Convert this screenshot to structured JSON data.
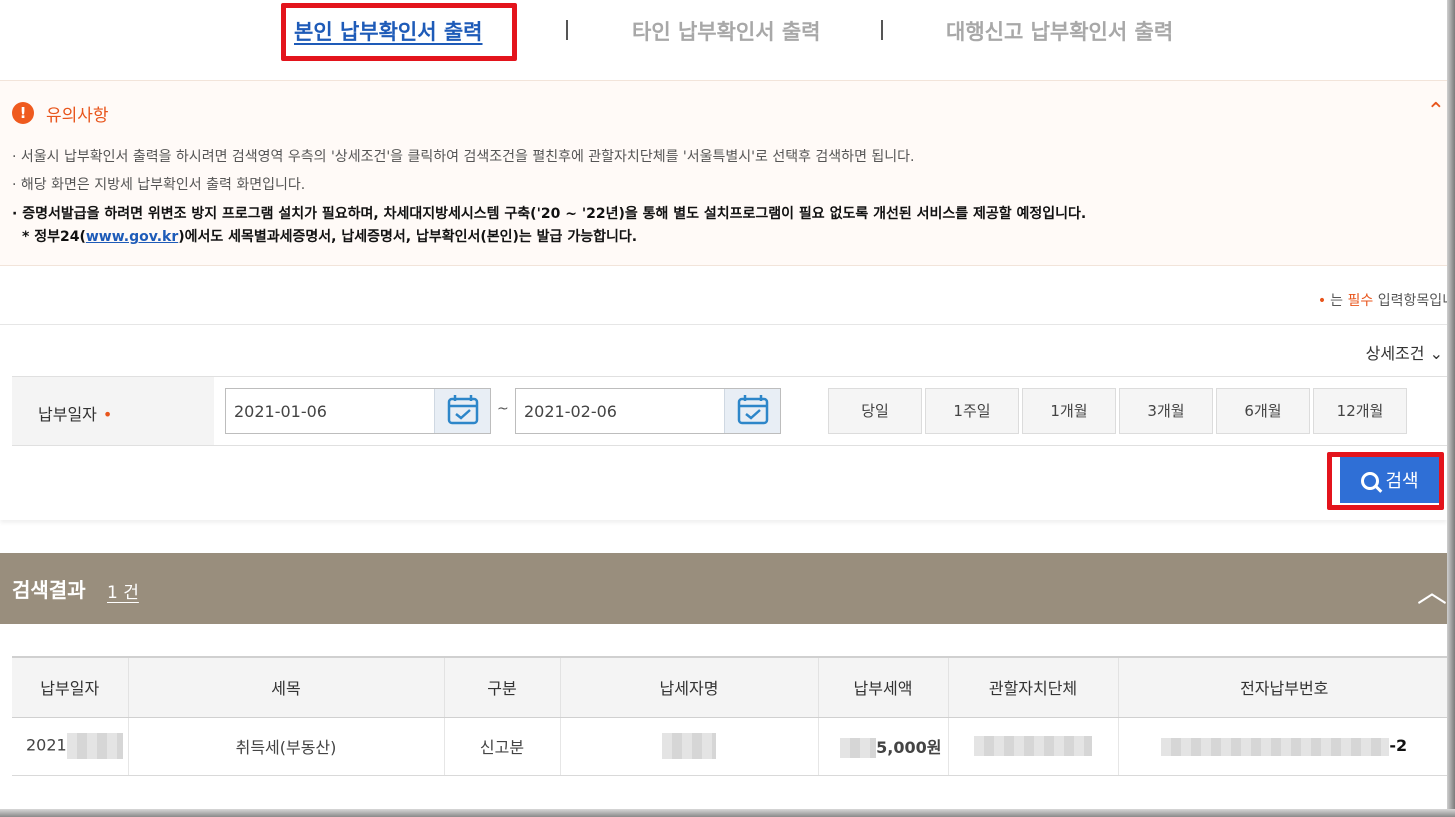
{
  "tabs": [
    {
      "label": "본인 납부확인서 출력",
      "active": true
    },
    {
      "label": "타인 납부확인서 출력",
      "active": false
    },
    {
      "label": "대행신고 납부확인서 출력",
      "active": false
    }
  ],
  "notice": {
    "title": "유의사항",
    "lines": [
      "· 서울시 납부확인서 출력을 하시려면 검색영역 우측의 '상세조건'을 클릭하여 검색조건을 펼친후에 관할자치단체를 '서울특별시'로 선택후 검색하면 됩니다.",
      "· 해당 화면은 지방세 납부확인서 출력 화면입니다.",
      "· 증명서발급을 하려면 위변조 방지 프로그램 설치가 필요하며, 차세대지방세시스템 구축('20 ~ '22년)을 통해 별도 설치프로그램이 필요 없도록 개선된 서비스를 제공할 예정입니다."
    ],
    "gov_prefix": "* 정부24(",
    "gov_link": "www.gov.kr",
    "gov_suffix": ")에서도 세목별과세증명서, 납세증명서, 납부확인서(본인)는 발급 가능합니다."
  },
  "required_note": {
    "prefix": "는 ",
    "required": "필수",
    "suffix": " 입력항목입니"
  },
  "search": {
    "detail_toggle": "상세조건",
    "field_label": "납부일자",
    "from_date": "2021-01-06",
    "to_date": "2021-02-06",
    "tilde": "~",
    "periods": [
      "당일",
      "1주일",
      "1개월",
      "3개월",
      "6개월",
      "12개월"
    ],
    "search_button": "검색"
  },
  "results": {
    "title": "검색결과",
    "count": "1 건",
    "columns": [
      "납부일자",
      "세목",
      "구분",
      "납세자명",
      "납부세액",
      "관할자치단체",
      "전자납부번호"
    ],
    "row": {
      "date_prefix": "2021",
      "tax_item": "취득세(부동산)",
      "category": "신고분",
      "amount_suffix": "5,000원",
      "number_suffix": "-2"
    }
  },
  "colors": {
    "accent": "#1e5bb8",
    "highlight": "#e3141c",
    "notice": "#e8551c",
    "results_bar": "#998e7d",
    "search_button": "#2f6fd6"
  }
}
